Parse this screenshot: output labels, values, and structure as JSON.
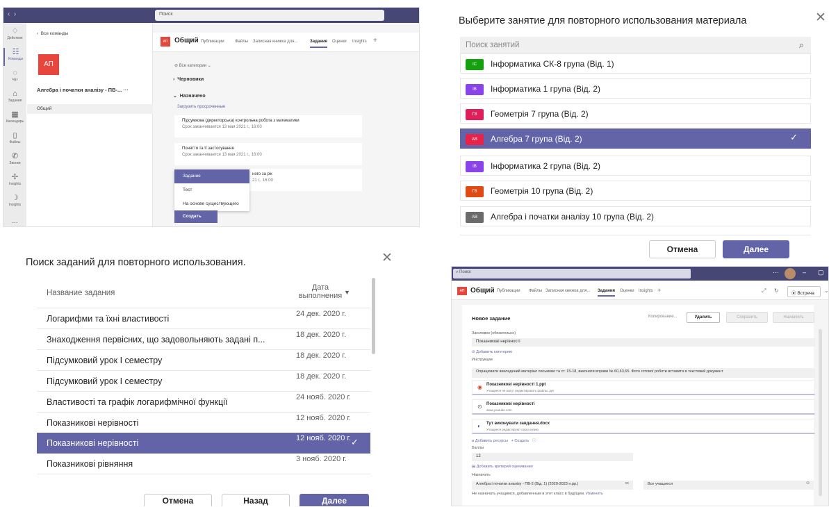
{
  "p1": {
    "search": "Поиск",
    "rail": [
      {
        "icon": "bell-icon",
        "label": "Действия"
      },
      {
        "icon": "teams-icon",
        "label": "Команды"
      },
      {
        "icon": "chat-icon",
        "label": "Чат"
      },
      {
        "icon": "assignments-icon",
        "label": "Задания"
      },
      {
        "icon": "calendar-icon",
        "label": "Календарь"
      },
      {
        "icon": "files-icon",
        "label": "Файлы"
      },
      {
        "icon": "calls-icon",
        "label": "Звонки"
      },
      {
        "icon": "insights-icon",
        "label": "Insights"
      },
      {
        "icon": "insights2-icon",
        "label": "Insights"
      }
    ],
    "rail_more": "...",
    "back": "Все команды",
    "tile": "АП",
    "team_name": "Алгебра і початки аналізу - ПВ-...",
    "team_more": "···",
    "channel": "Общий",
    "avatar": "АП",
    "channel_title": "Общий",
    "tabs": [
      "Публикации",
      "Файлы",
      "Записная книжка для...",
      "Задания",
      "Оценки",
      "Insights"
    ],
    "categories": "Все категории",
    "drafts": "Черновики",
    "assigned": "Назначено",
    "view_overdue": "Загрузить просроченные",
    "cards": [
      {
        "title": "Підсумкова (директорська) контрольна робота з математики",
        "due": "Срок заканчивается 13 мая 2021 г., 16:00"
      },
      {
        "title": "Поняття та її застосування",
        "due": "Срок заканчивается 13 мая 2021 г., 16:00"
      },
      {
        "title": "ного за рік",
        "due": "21 г., 16:00"
      }
    ],
    "menu": [
      "Задание",
      "Тест",
      "На основе существующего"
    ],
    "create": "Создать"
  },
  "p2": {
    "title": "Выберите занятие для повторного использования материала",
    "search": "Поиск занятий",
    "rows": [
      {
        "badge": "ІС",
        "color": "#13a10e",
        "label": "Інформатика СК-8 група (Від. 1)"
      },
      {
        "badge": "ІВ",
        "color": "#8a43e8",
        "label": "Інформатика 1 група (Від. 2)"
      },
      {
        "badge": "ГВ",
        "color": "#e01f5a",
        "label": "Геометрія 7 група (Від. 2)"
      },
      {
        "badge": "АВ",
        "color": "#e8234a",
        "label": "Алгебра 7 група (Від. 2)",
        "selected": true
      },
      {
        "badge": "ІВ",
        "color": "#8a43e8",
        "label": "Інформатика 2 група (Від. 2)"
      },
      {
        "badge": "ГВ",
        "color": "#e04a15",
        "label": "Геометрія 10 група (Від. 2)"
      },
      {
        "badge": "АВ",
        "color": "#6b6b6b",
        "label": "Алгебра і початки аналізу 10 група (Від. 2)"
      }
    ],
    "cancel": "Отмена",
    "next": "Далее"
  },
  "p3": {
    "title": "Поиск заданий для повторного использования.",
    "col_name": "Название задания",
    "col_date": "Дата выполнения",
    "rows": [
      {
        "name": "Логарифми та їхні властивості",
        "date": "24 дек. 2020 г."
      },
      {
        "name": "Знаходження первісних, що задовольняють задані п...",
        "date": "18 дек. 2020 г."
      },
      {
        "name": "Підсумковий урок І семестру",
        "date": "18 дек. 2020 г."
      },
      {
        "name": "Підсумковий урок І семестру",
        "date": "18 дек. 2020 г."
      },
      {
        "name": "Властивості та графік логарифмічної функції",
        "date": "24 нояб. 2020 г."
      },
      {
        "name": "Показникові нерівності",
        "date": "12 нояб. 2020 г."
      },
      {
        "name": "Показникові нерівності",
        "date": "12 нояб. 2020 г.",
        "selected": true
      },
      {
        "name": "Показникові рівняння",
        "date": "3 нояб. 2020 г."
      }
    ],
    "cancel": "Отмена",
    "back": "Назад",
    "next": "Далее"
  },
  "p4": {
    "search": "Поиск",
    "avatar": "АП",
    "channel_title": "Общий",
    "tabs": [
      "Публикации",
      "Файлы",
      "Записная книжка для...",
      "Задания",
      "Оценки",
      "Insights"
    ],
    "meet": "Встреча",
    "heading": "Новое задание",
    "status": "Копирование...",
    "delete": "Удалить",
    "save": "Сохранить",
    "assign": "Назначить",
    "title_label": "Заголовок (обязательно)",
    "title_value": "Показникові нерівності",
    "add_category": "Добавить категорию",
    "instr_label": "Инструкции",
    "instr_value": "Опрацювати викладений матеріал письмово та ст. 15-18, виконати вправи № 60,63,65. Фото готової роботи вставити в текстовий документ",
    "resources": [
      {
        "icon": "pptx-icon",
        "title": "Показникові нерівності 1.ppt",
        "sub": "Учащиеся не могут редактировать файлы .ppt"
      },
      {
        "icon": "link-icon",
        "title": "Показникові нерівності",
        "sub": "www.youtube.com"
      },
      {
        "icon": "word-icon",
        "title": "Тут виконувати завдання.docx",
        "sub": "Учащиеся редактируют свою копию"
      }
    ],
    "add_resources": "Добавить ресурсы",
    "create": "Создать",
    "points_label": "Баллы",
    "points_value": "12",
    "rubric": "Добавить критерий оценивания",
    "assign_label": "Назначить",
    "assign_class": "Алгебра і початки аналізу - ПВ-2 (Від. 1) (2020-2023 н.рр.)",
    "assign_students": "Все учащиеся",
    "note": "Не назначать учащимся, добавленным в этот класс в будущем.",
    "edit": "Изменить"
  }
}
